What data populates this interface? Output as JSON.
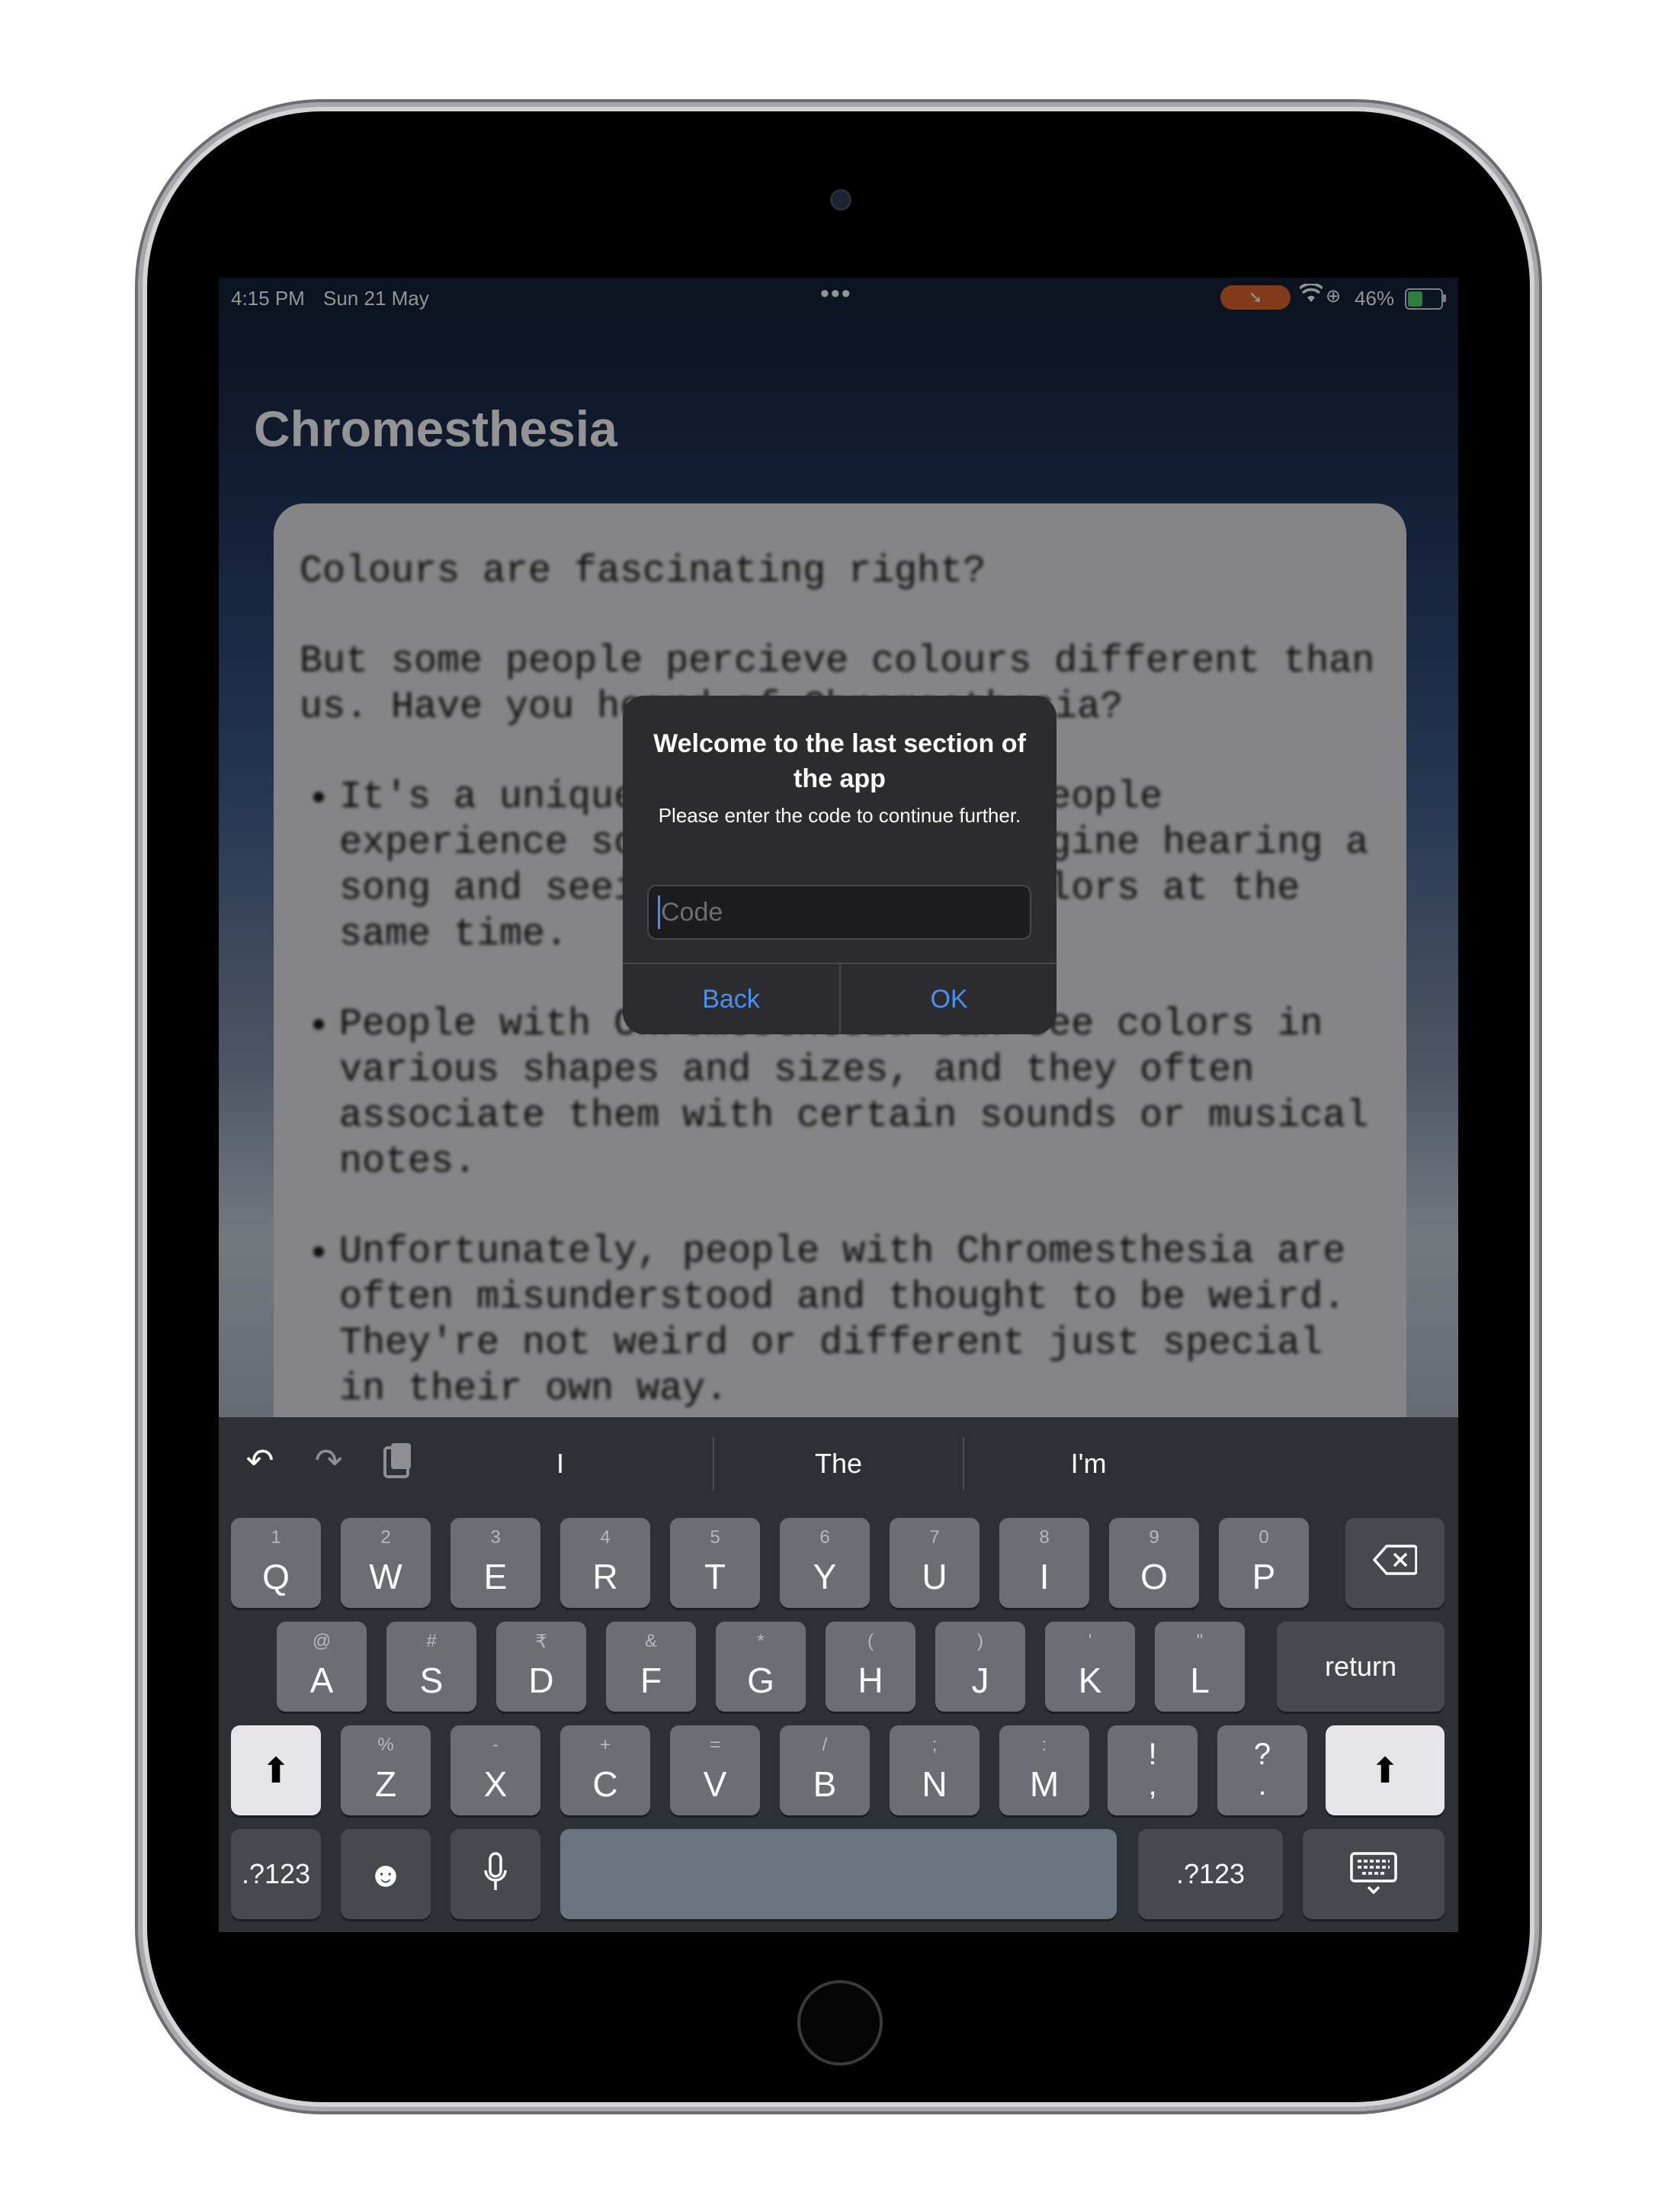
{
  "status_bar": {
    "time": "4:15 PM",
    "date": "Sun 21 May",
    "battery": "46%",
    "battery_level": 0.46,
    "pill_color": "#e0642c"
  },
  "app": {
    "title": "Chromesthesia",
    "paragraphs": [
      "Colours are fascinating right?",
      "But some people percieve colours different than us. Have you heard of Chromesthesia?"
    ],
    "bullets": [
      "It's a unique condition where people experience sound as colour. Imagine hearing a song and seeing a rainbow of colors at the same time.",
      "People with Chromesthesia can see colors in various shapes and sizes, and they often associate them with certain sounds or musical notes.",
      "Unfortunately, people with Chromesthesia are often misunderstood and thought to be weird.",
      "They're not weird or different just special in their own way."
    ]
  },
  "alert": {
    "title": "Welcome to the last section of the app",
    "message": "Please enter the code to continue further.",
    "input_placeholder": "Code",
    "input_value": "",
    "back_label": "Back",
    "ok_label": "OK",
    "accent_color": "#4a90f0"
  },
  "keyboard": {
    "suggestions": [
      "I",
      "The",
      "I'm"
    ],
    "tools": [
      "undo-icon",
      "redo-icon",
      "clipboard-icon"
    ],
    "row1": [
      {
        "main": "Q",
        "alt": "1"
      },
      {
        "main": "W",
        "alt": "2"
      },
      {
        "main": "E",
        "alt": "3"
      },
      {
        "main": "R",
        "alt": "4"
      },
      {
        "main": "T",
        "alt": "5"
      },
      {
        "main": "Y",
        "alt": "6"
      },
      {
        "main": "U",
        "alt": "7"
      },
      {
        "main": "I",
        "alt": "8"
      },
      {
        "main": "O",
        "alt": "9"
      },
      {
        "main": "P",
        "alt": "0"
      }
    ],
    "row2": [
      {
        "main": "A",
        "alt": "@"
      },
      {
        "main": "S",
        "alt": "#"
      },
      {
        "main": "D",
        "alt": "₹"
      },
      {
        "main": "F",
        "alt": "&"
      },
      {
        "main": "G",
        "alt": "*"
      },
      {
        "main": "H",
        "alt": "("
      },
      {
        "main": "J",
        "alt": ")"
      },
      {
        "main": "K",
        "alt": "'"
      },
      {
        "main": "L",
        "alt": "\""
      }
    ],
    "row3": [
      {
        "main": "Z",
        "alt": "%"
      },
      {
        "main": "X",
        "alt": "-"
      },
      {
        "main": "C",
        "alt": "+"
      },
      {
        "main": "V",
        "alt": "="
      },
      {
        "main": "B",
        "alt": "/"
      },
      {
        "main": "N",
        "alt": ";"
      },
      {
        "main": "M",
        "alt": ":"
      }
    ],
    "exclaim_top": "!",
    "exclaim_bottom": ",",
    "question_top": "?",
    "question_bottom": ".",
    "return_label": "return",
    "numbers_label": ".?123"
  }
}
